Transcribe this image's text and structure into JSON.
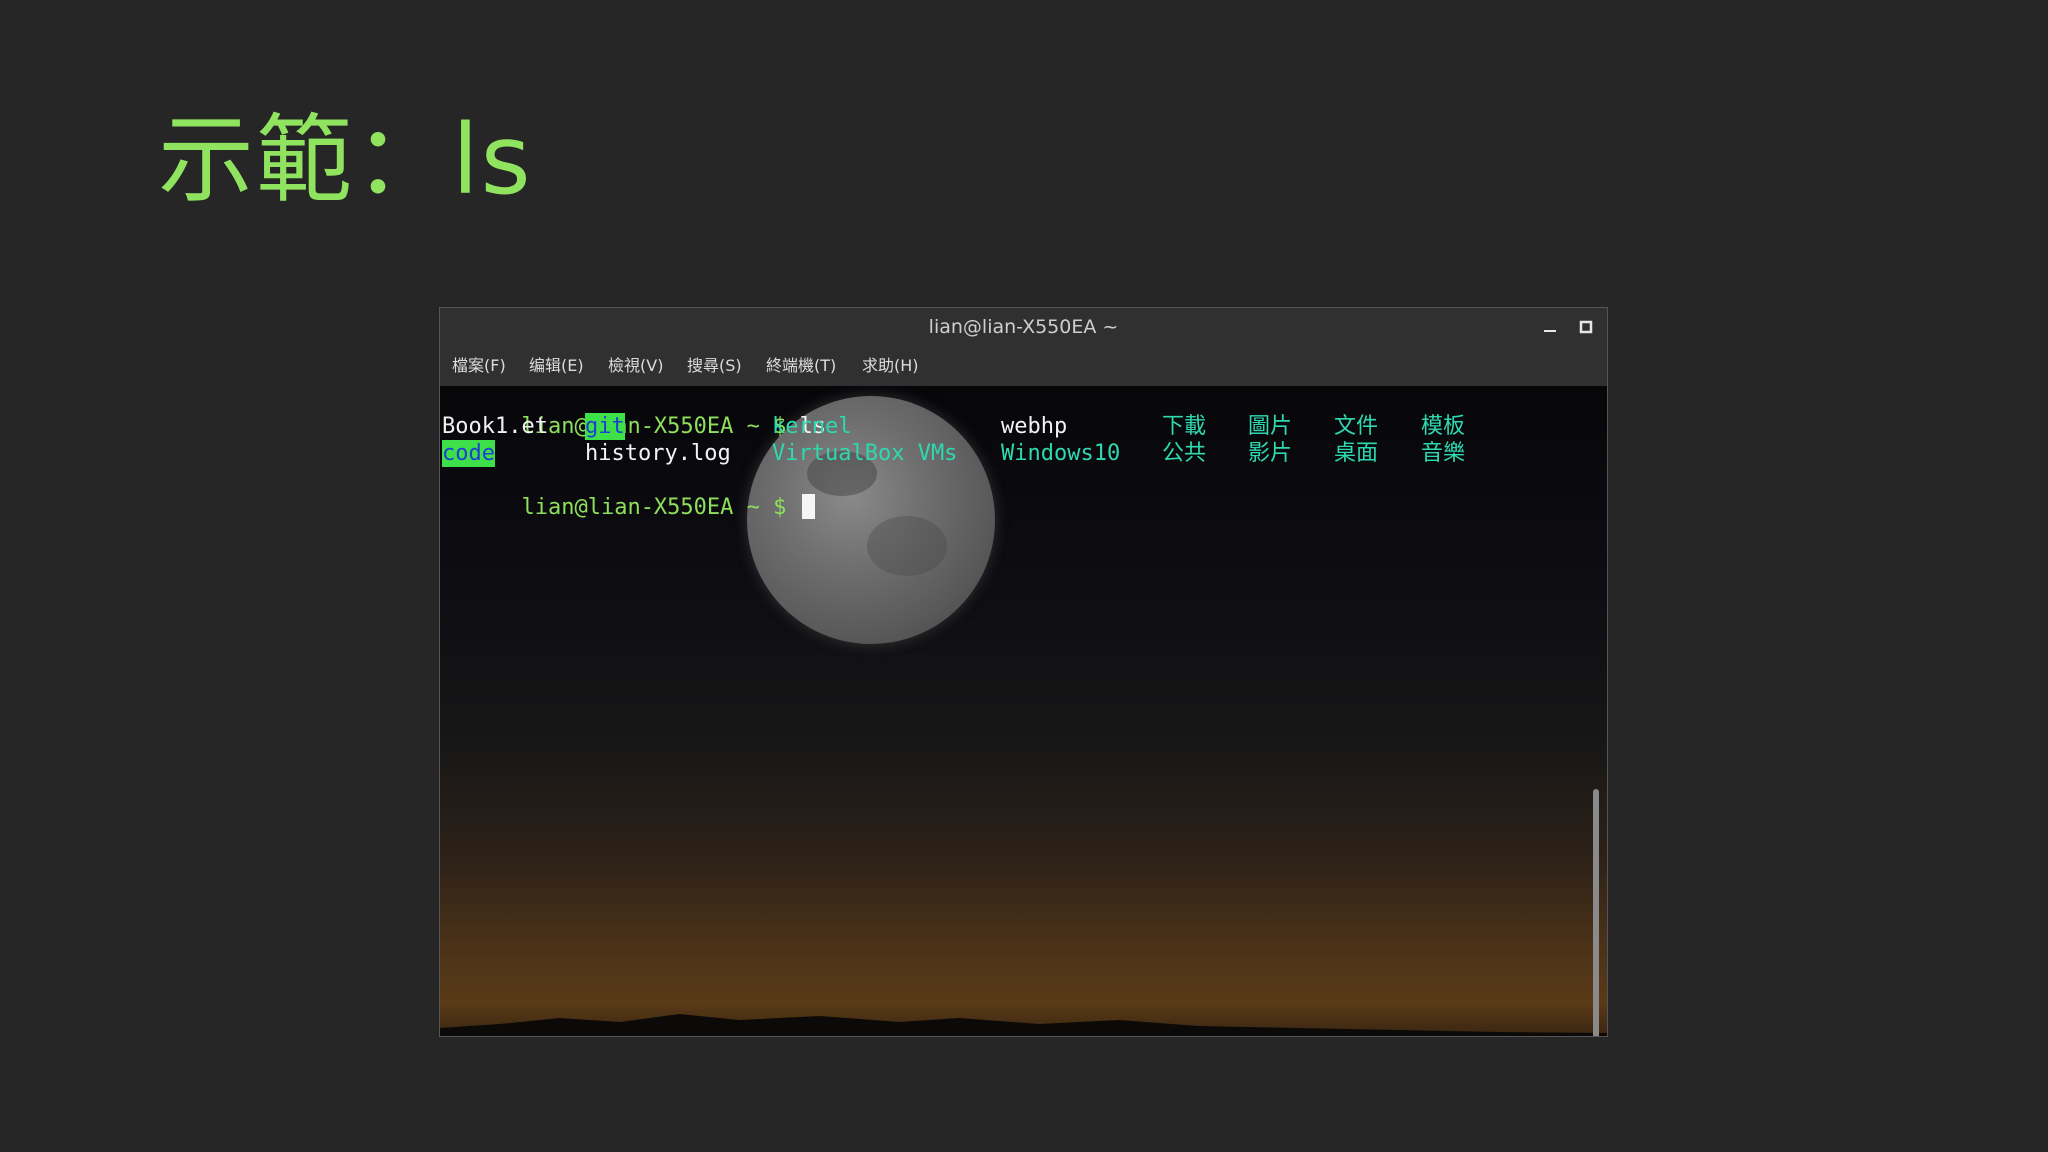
{
  "slide": {
    "title": "示範：ls"
  },
  "window": {
    "title": "lian@lian-X550EA ~",
    "controls": {
      "minimize": "–",
      "maximize": "□",
      "close": "✕"
    }
  },
  "menu": {
    "items": [
      "檔案(F)",
      "编辑(E)",
      "檢視(V)",
      "搜尋(S)",
      "終端機(T)",
      "求助(H)"
    ]
  },
  "terminal": {
    "prompt": "lian@lian-X550EA ~ $",
    "command": "ls",
    "row1": [
      "Book1.et",
      "git",
      "kernel",
      "webhp",
      "下載",
      "圖片",
      "文件",
      "模板"
    ],
    "row2": [
      "code",
      "history.log",
      "VirtualBox VMs",
      "Windows10",
      "公共",
      "影片",
      "桌面",
      "音樂"
    ]
  },
  "colors": {
    "title": "#8fe35f",
    "prompt": "#8ee05c",
    "directory": "#2ed9b0",
    "highlight_bg": "#3ee04a",
    "highlight_fg": "#1e3fd0"
  }
}
